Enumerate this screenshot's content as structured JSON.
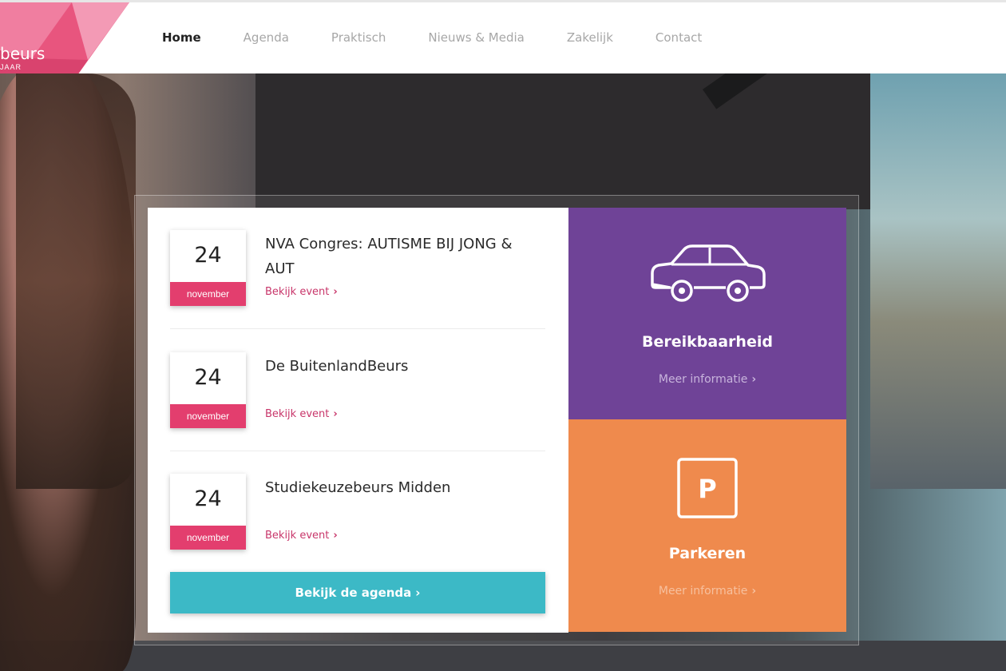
{
  "logo": {
    "text": "beurs",
    "subtext": "JAAR"
  },
  "nav": {
    "items": [
      {
        "label": "Home",
        "active": true
      },
      {
        "label": "Agenda",
        "active": false
      },
      {
        "label": "Praktisch",
        "active": false
      },
      {
        "label": "Nieuws & Media",
        "active": false
      },
      {
        "label": "Zakelijk",
        "active": false
      },
      {
        "label": "Contact",
        "active": false
      }
    ]
  },
  "events": [
    {
      "day": "24",
      "month": "november",
      "title": "NVA Congres: AUTISME BIJ JONG & AUT",
      "link": "Bekijk event"
    },
    {
      "day": "24",
      "month": "november",
      "title": "De BuitenlandBeurs",
      "link": "Bekijk event"
    },
    {
      "day": "24",
      "month": "november",
      "title": "Studiekeuzebeurs Midden",
      "link": "Bekijk event"
    }
  ],
  "agenda_button": "Bekijk de agenda",
  "tiles": {
    "bereikbaarheid": {
      "title": "Bereikbaarheid",
      "link": "Meer informatie",
      "icon": "car-icon",
      "color": "#6f4397"
    },
    "parkeren": {
      "title": "Parkeren",
      "link": "Meer informatie",
      "icon": "parking-icon",
      "color": "#ef8a4d"
    }
  },
  "colors": {
    "accent_pink": "#e33e6e",
    "button_teal": "#3cb9c6"
  }
}
